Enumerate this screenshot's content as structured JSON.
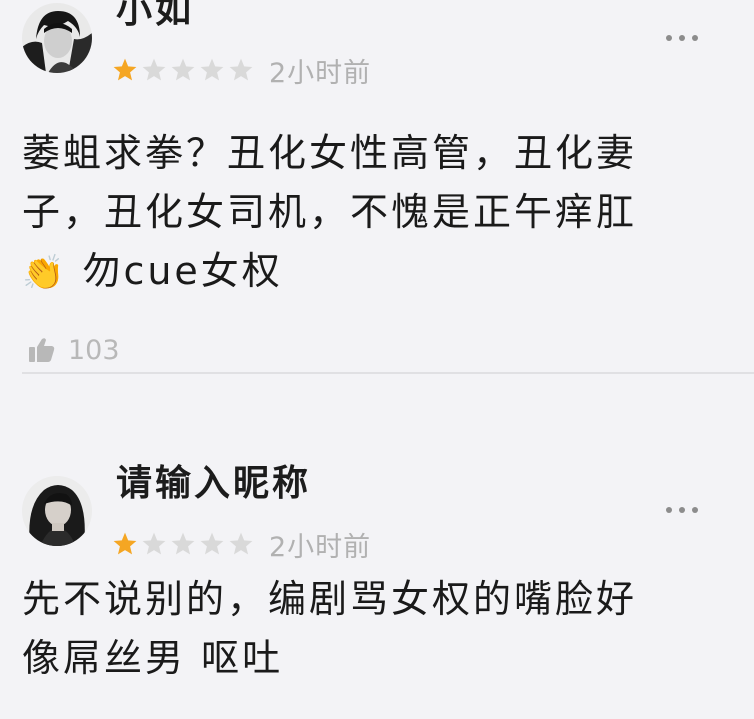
{
  "comments": [
    {
      "username": "小如",
      "rating": 1,
      "max_rating": 5,
      "timestamp": "2小时前",
      "text_lines": [
        "萎蛆求拳？丑化女性高管，丑化妻",
        "子，丑化女司机，不愧是正午痒肛"
      ],
      "emoji": "👏",
      "text_tail": "勿cue女权",
      "likes": "103"
    },
    {
      "username": "请输入昵称",
      "rating": 1,
      "max_rating": 5,
      "timestamp": "2小时前",
      "text_lines": [
        "先不说别的，编剧骂女权的嘴脸好",
        "像屌丝男 呕吐"
      ]
    }
  ],
  "icons": {
    "more": "more-horizontal-icon",
    "like": "thumbs-up-icon",
    "star_filled": "star-filled-icon",
    "star_empty": "star-empty-icon"
  },
  "colors": {
    "background": "#f3f3f6",
    "star_filled": "#f5a623",
    "star_empty": "#d9d9d9",
    "muted_text": "#b1b1b1"
  }
}
